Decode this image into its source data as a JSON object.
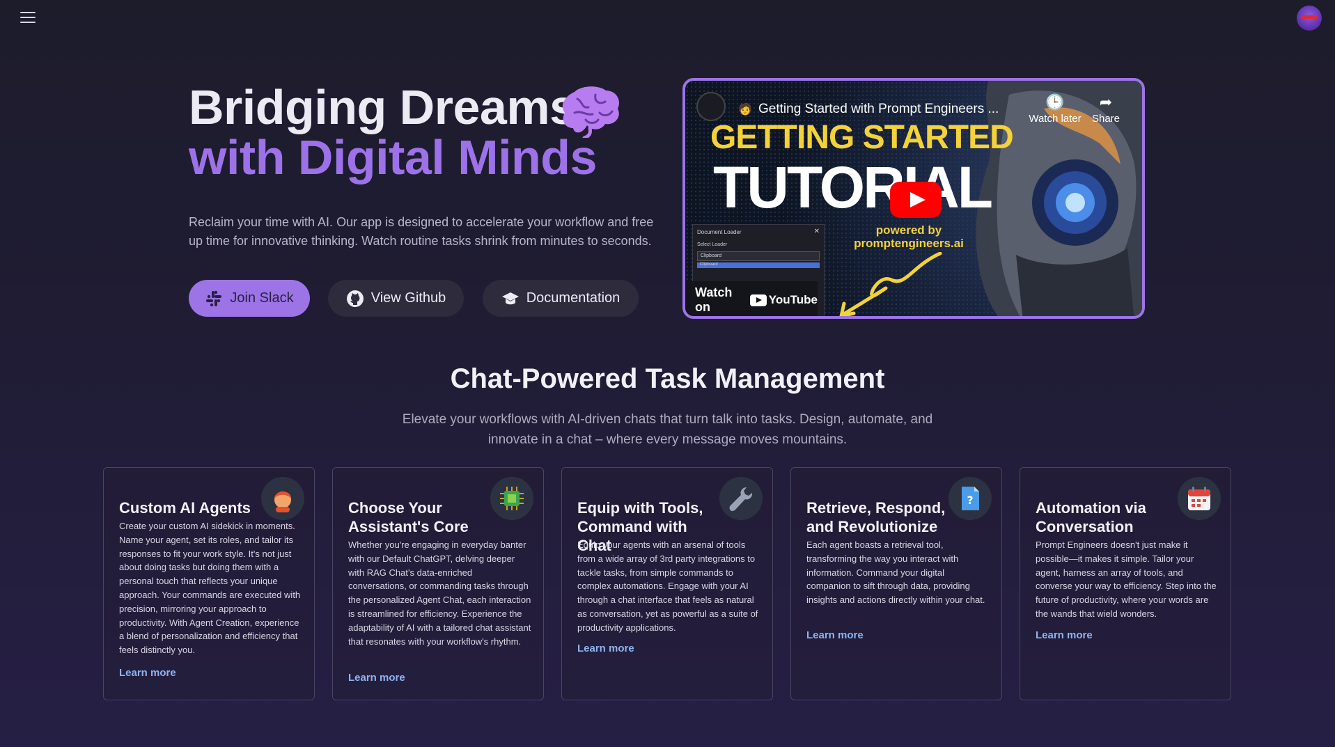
{
  "topbar": {
    "menu_icon": "hamburger-menu-icon",
    "avatar_icon": "ninja-avatar-icon"
  },
  "hero": {
    "title_line1": "Bridging Dreams",
    "title_line2": "with Digital Minds",
    "brain_icon": "brain-icon",
    "subtitle": "Reclaim your time with AI. Our app is designed to accelerate your workflow and free up time for innovative thinking. Watch routine tasks shrink from minutes to seconds.",
    "buttons": {
      "slack": "Join Slack",
      "github": "View Github",
      "docs": "Documentation"
    }
  },
  "video": {
    "title": "Getting Started with Prompt Engineers ...",
    "watch_later": "Watch later",
    "share": "Share",
    "thumb_line1": "GETTING STARTED",
    "thumb_line2": "TUTORIAL",
    "powered_line1": "powered by",
    "powered_line2": "promptengineers.ai",
    "panel_title": "Document Loader",
    "panel_label": "Select Loader",
    "panel_value": "Clipboard",
    "watch_on": "Watch on",
    "youtube": "YouTube"
  },
  "section": {
    "title": "Chat-Powered Task Management",
    "subtitle": "Elevate your workflows with AI-driven chats that turn talk into tasks. Design, automate, and innovate in a chat – where every message moves mountains."
  },
  "cards": [
    {
      "title": "Custom AI Agents",
      "icon": "person-icon",
      "body": "Create your custom AI sidekick in moments. Name your agent, set its roles, and tailor its responses to fit your work style. It's not just about doing tasks but doing them with a personal touch that reflects your unique approach. Your commands are executed with precision, mirroring your approach to productivity. With Agent Creation, experience a blend of personalization and efficiency that feels distinctly you.",
      "link": "Learn more"
    },
    {
      "title": "Choose Your Assistant's Core",
      "icon": "chip-icon",
      "body": "Whether you're engaging in everyday banter with our Default ChatGPT, delving deeper with RAG Chat's data-enriched conversations, or commanding tasks through the personalized Agent Chat, each interaction is streamlined for efficiency. Experience the adaptability of AI with a tailored chat assistant that resonates with your workflow's rhythm.",
      "link": "Learn more"
    },
    {
      "title": "Equip with Tools, Command with Chat",
      "icon": "wrench-icon",
      "body": "Equip your agents with an arsenal of tools from a wide array of 3rd party integrations to tackle tasks, from simple commands to complex automations. Engage with your AI through a chat interface that feels as natural as conversation, yet as powerful as a suite of productivity applications.",
      "link": "Learn more"
    },
    {
      "title": "Retrieve, Respond, and Revolutionize",
      "icon": "document-question-icon",
      "body": "Each agent boasts a retrieval tool, transforming the way you interact with information. Command your digital companion to sift through data, providing insights and actions directly within your chat.",
      "link": "Learn more"
    },
    {
      "title": "Automation via Conversation",
      "icon": "calendar-icon",
      "body": "Prompt Engineers doesn't just make it possible—it makes it simple. Tailor your agent, harness an array of tools, and converse your way to efficiency. Step into the future of productivity, where your words are the wands that wield wonders.",
      "link": "Learn more"
    }
  ],
  "colors": {
    "accent": "#9c74e6",
    "link": "#8fb3f0",
    "background": "#1f1c33"
  }
}
